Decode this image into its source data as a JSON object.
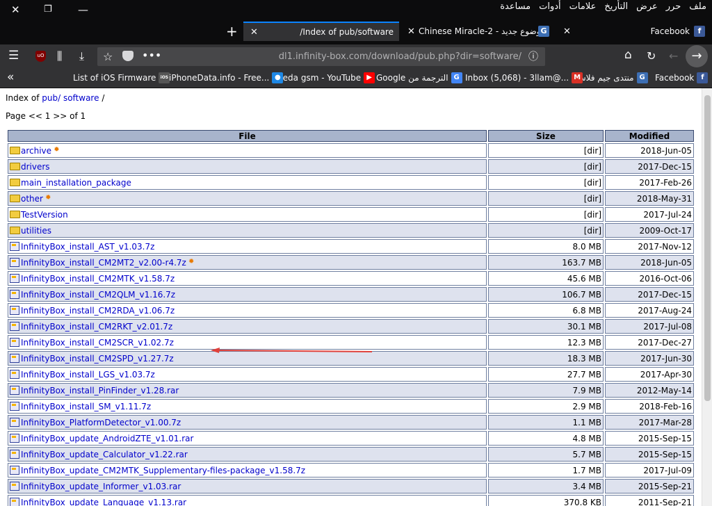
{
  "menu": [
    "ملف",
    "حرر",
    "عرض",
    "التأريخ",
    "علامات",
    "أدوات",
    "مساعدة"
  ],
  "tabs": [
    {
      "title": "Facebook",
      "icon": "facebook-icon",
      "color": "#3b5998",
      "active": false
    },
    {
      "title": "Chinese Miracle-2 - وضوع جديد",
      "icon": "g-icon",
      "color": "#3d6fb4",
      "active": false
    },
    {
      "title": "/Index of pub/software",
      "icon": "",
      "active": true
    }
  ],
  "url": "dl1.infinity-box.com/download/pub.php?dir=software/",
  "bookmarks": [
    {
      "label": "Facebook",
      "icon": "facebook-icon",
      "color": "#3b5998"
    },
    {
      "label": "منتدى جيم فلاش",
      "icon": "g-icon",
      "color": "#3d6fb4"
    },
    {
      "label": "Inbox (5,068) - 3llam@...",
      "icon": "gmail-icon",
      "color": "#d93025"
    },
    {
      "label": "Google الترجمة من",
      "icon": "translate-icon",
      "color": "#4285f4"
    },
    {
      "label": "reda gsm - YouTube",
      "icon": "youtube-icon",
      "color": "#ff0000"
    },
    {
      "label": "iPhoneData.info - Free...",
      "icon": "apple-icon",
      "color": "#1e88e5"
    },
    {
      "label": "List of iOS Firmware",
      "icon": "ios-icon",
      "color": "#555555"
    }
  ],
  "breadcrumb": {
    "prefix": "Index of ",
    "pub": "pub/",
    "software": "software",
    "suffix": " /"
  },
  "paging": "Page << 1 >> of 1",
  "table": {
    "headers": [
      "File",
      "Size",
      "Modified"
    ],
    "rows": [
      {
        "name": "archive",
        "type": "dir",
        "size": "[dir]",
        "modified": "2018-Jun-05",
        "new": true
      },
      {
        "name": "drivers",
        "type": "dir",
        "size": "[dir]",
        "modified": "2017-Dec-15",
        "new": false
      },
      {
        "name": "main_installation_package",
        "type": "dir",
        "size": "[dir]",
        "modified": "2017-Feb-26",
        "new": false
      },
      {
        "name": "other",
        "type": "dir",
        "size": "[dir]",
        "modified": "2018-May-31",
        "new": true
      },
      {
        "name": "TestVersion",
        "type": "dir",
        "size": "[dir]",
        "modified": "2017-Jul-24",
        "new": false
      },
      {
        "name": "utilities",
        "type": "dir",
        "size": "[dir]",
        "modified": "2009-Oct-17",
        "new": false
      },
      {
        "name": "InfinityBox_install_AST_v1.03.7z",
        "type": "file",
        "size": "8.0 MB",
        "modified": "2017-Nov-12",
        "new": false
      },
      {
        "name": "InfinityBox_install_CM2MT2_v2.00-r4.7z",
        "type": "file",
        "size": "163.7 MB",
        "modified": "2018-Jun-05",
        "new": true
      },
      {
        "name": "InfinityBox_install_CM2MTK_v1.58.7z",
        "type": "file",
        "size": "45.6 MB",
        "modified": "2016-Oct-06",
        "new": false
      },
      {
        "name": "InfinityBox_install_CM2QLM_v1.16.7z",
        "type": "file",
        "size": "106.7 MB",
        "modified": "2017-Dec-15",
        "new": false
      },
      {
        "name": "InfinityBox_install_CM2RDA_v1.06.7z",
        "type": "file",
        "size": "6.8 MB",
        "modified": "2017-Aug-24",
        "new": false
      },
      {
        "name": "InfinityBox_install_CM2RKT_v2.01.7z",
        "type": "file",
        "size": "30.1 MB",
        "modified": "2017-Jul-08",
        "new": false
      },
      {
        "name": "InfinityBox_install_CM2SCR_v1.02.7z",
        "type": "file",
        "size": "12.3 MB",
        "modified": "2017-Dec-27",
        "new": false
      },
      {
        "name": "InfinityBox_install_CM2SPD_v1.27.7z",
        "type": "file",
        "size": "18.3 MB",
        "modified": "2017-Jun-30",
        "new": false
      },
      {
        "name": "InfinityBox_install_LGS_v1.03.7z",
        "type": "file",
        "size": "27.7 MB",
        "modified": "2017-Apr-30",
        "new": false
      },
      {
        "name": "InfinityBox_install_PinFinder_v1.28.rar",
        "type": "file",
        "size": "7.9 MB",
        "modified": "2012-May-14",
        "new": false
      },
      {
        "name": "InfinityBox_install_SM_v1.11.7z",
        "type": "file",
        "size": "2.9 MB",
        "modified": "2018-Feb-16",
        "new": false
      },
      {
        "name": "InfinityBox_PlatformDetector_v1.00.7z",
        "type": "file",
        "size": "1.1 MB",
        "modified": "2017-Mar-28",
        "new": false
      },
      {
        "name": "InfinityBox_update_AndroidZTE_v1.01.rar",
        "type": "file",
        "size": "4.8 MB",
        "modified": "2015-Sep-15",
        "new": false
      },
      {
        "name": "InfinityBox_update_Calculator_v1.22.rar",
        "type": "file",
        "size": "5.7 MB",
        "modified": "2015-Sep-15",
        "new": false
      },
      {
        "name": "InfinityBox_update_CM2MTK_Supplementary-files-package_v1.58.7z",
        "type": "file",
        "size": "1.7 MB",
        "modified": "2017-Jul-09",
        "new": false
      },
      {
        "name": "InfinityBox_update_Informer_v1.03.rar",
        "type": "file",
        "size": "3.4 MB",
        "modified": "2015-Sep-21",
        "new": false
      },
      {
        "name": "InfinityBox_update_Language_v1.13.rar",
        "type": "file",
        "size": "370.8 KB",
        "modified": "2011-Sep-21",
        "new": false
      }
    ]
  },
  "annotation_color": "#e0403a"
}
